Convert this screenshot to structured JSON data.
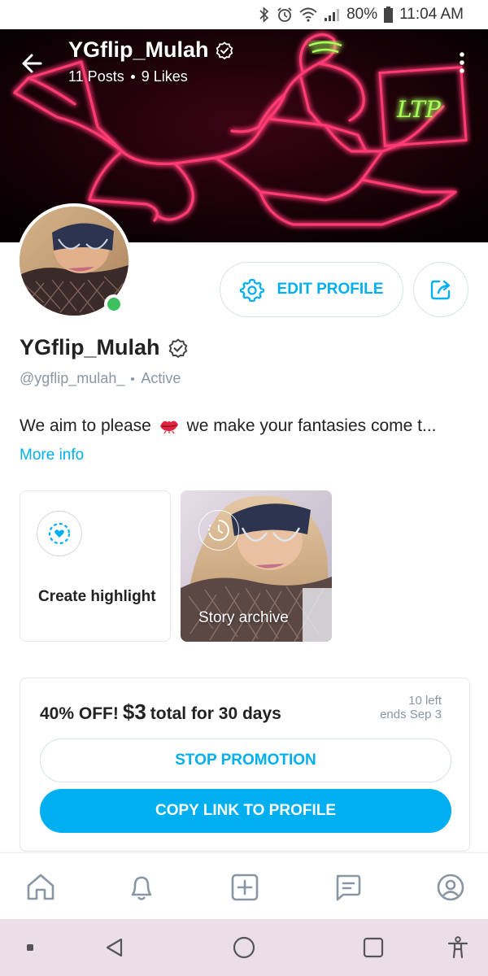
{
  "status_bar": {
    "battery": "80%",
    "time": "11:04 AM"
  },
  "cover": {
    "title": "YGflip_Mulah",
    "posts": "11 Posts",
    "likes": "9 Likes",
    "neon_sign_text": "LTP"
  },
  "actions": {
    "edit_profile": "EDIT PROFILE"
  },
  "profile": {
    "name": "YGflip_Mulah",
    "handle": "@ygflip_mulah_",
    "status": "Active",
    "bio_start": "We aim to please",
    "bio_end": "we make your fantasies come t...",
    "more_info": "More info"
  },
  "highlights": {
    "create_label": "Create highlight",
    "archive_label": "Story archive"
  },
  "promotion": {
    "title_prefix": "40% OFF!",
    "price": "$3",
    "title_suffix": "total for 30 days",
    "left": "10 left",
    "ends": "ends Sep 3",
    "stop_label": "STOP PROMOTION",
    "copy_label": "COPY LINK TO PROFILE"
  },
  "colors": {
    "accent": "#00aff0",
    "online": "#3cc05c",
    "muted": "#8a96a3",
    "neon_pink": "#ff2d6b",
    "neon_green": "#9dff4a"
  },
  "icons": {
    "status": [
      "bluetooth-icon",
      "alarm-icon",
      "wifi-icon",
      "signal-icon",
      "battery-icon"
    ],
    "bottom_nav": [
      "home-icon",
      "bell-icon",
      "plus-square-icon",
      "chat-icon",
      "profile-icon"
    ],
    "system_nav": [
      "dot-icon",
      "back-triangle-icon",
      "home-circle-icon",
      "recents-square-icon",
      "accessibility-icon"
    ]
  }
}
